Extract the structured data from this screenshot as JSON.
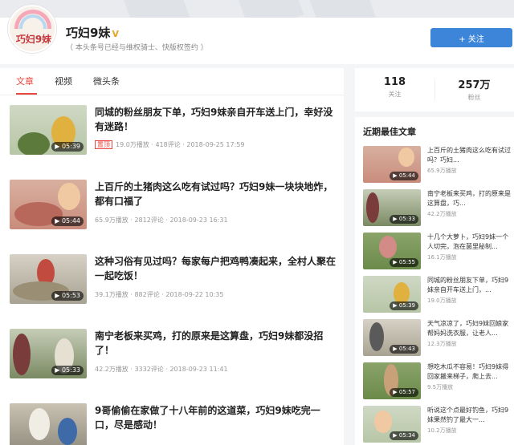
{
  "author": {
    "avatar_text": "巧妇9妹",
    "name": "巧妇9妹",
    "badge": "V",
    "desc": "（ 本头条号已经与维权骑士、快版权签约 ）",
    "follow_label": "+ 关注"
  },
  "tabs": [
    {
      "label": "文章"
    },
    {
      "label": "视频"
    },
    {
      "label": "微头条"
    }
  ],
  "articles": [
    {
      "title": "同城的粉丝朋友下单，巧妇9妹亲自开车送上门，幸好没有迷路！",
      "duration": "▶ 05:39",
      "tag": "置顶",
      "views": "19.0万播放",
      "comments": "418评论",
      "date": "2018-09-25 17:59"
    },
    {
      "title": "上百斤的土猪肉这么吃有试过吗？巧妇9妹一块块地炸，都有口福了",
      "duration": "▶ 05:44",
      "tag": "",
      "views": "65.9万播放",
      "comments": "2812评论",
      "date": "2018-09-23 16:31"
    },
    {
      "title": "这种习俗有见过吗？每家每户把鸡鸭凑起来，全村人聚在一起吃饭！",
      "duration": "▶ 05:53",
      "tag": "",
      "views": "39.1万播放",
      "comments": "882评论",
      "date": "2018-09-22 10:35"
    },
    {
      "title": "南宁老板来买鸡，打的原来是这算盘，巧妇9妹都没招了！",
      "duration": "▶ 05:33",
      "tag": "",
      "views": "42.2万播放",
      "comments": "3332评论",
      "date": "2018-09-23 11:41"
    },
    {
      "title": "9哥偷偷在家做了十八年前的这道菜，巧妇9妹吃完一口，尽是感动！",
      "duration": "",
      "tag": "",
      "views": "",
      "comments": "",
      "date": ""
    }
  ],
  "stats": {
    "follow_count": "118",
    "follow_label": "关注",
    "fans_count": "257万",
    "fans_label": "粉丝"
  },
  "best": {
    "title": "近期最佳文章",
    "items": [
      {
        "text": "上百斤的土猪肉这么吃有试过吗？巧妇...",
        "views": "65.9万播放",
        "duration": "▶ 05:44"
      },
      {
        "text": "南宁老板来买鸡，打的原来是这算盘，巧...",
        "views": "42.2万播放",
        "duration": "▶ 05:33"
      },
      {
        "text": "十几个大萝卜，巧妇9妹一个人切完，泡在菌里秘制...",
        "views": "16.1万播放",
        "duration": "▶ 05:55"
      },
      {
        "text": "同城的粉丝朋友下单，巧妇9妹亲自开车送上门，...",
        "views": "19.0万播放",
        "duration": "▶ 05:39"
      },
      {
        "text": "天气凉凉了，巧妇9妹回娘家帮妈妈洗衣服，让老人...",
        "views": "12.3万播放",
        "duration": "▶ 05:43"
      },
      {
        "text": "想吃木瓜不容易！巧妇9妹得回家搬来梯子，爬上去...",
        "views": "9.5万播放",
        "duration": "▶ 05:57"
      },
      {
        "text": "听说这个点最好钓鱼，巧妇9妹果然钓了最大一...",
        "views": "10.2万播放",
        "duration": "▶ 05:34"
      }
    ]
  },
  "colors": {
    "accent": "#e8473d",
    "follow_button": "#3d85d9",
    "badge": "#e8a325"
  }
}
